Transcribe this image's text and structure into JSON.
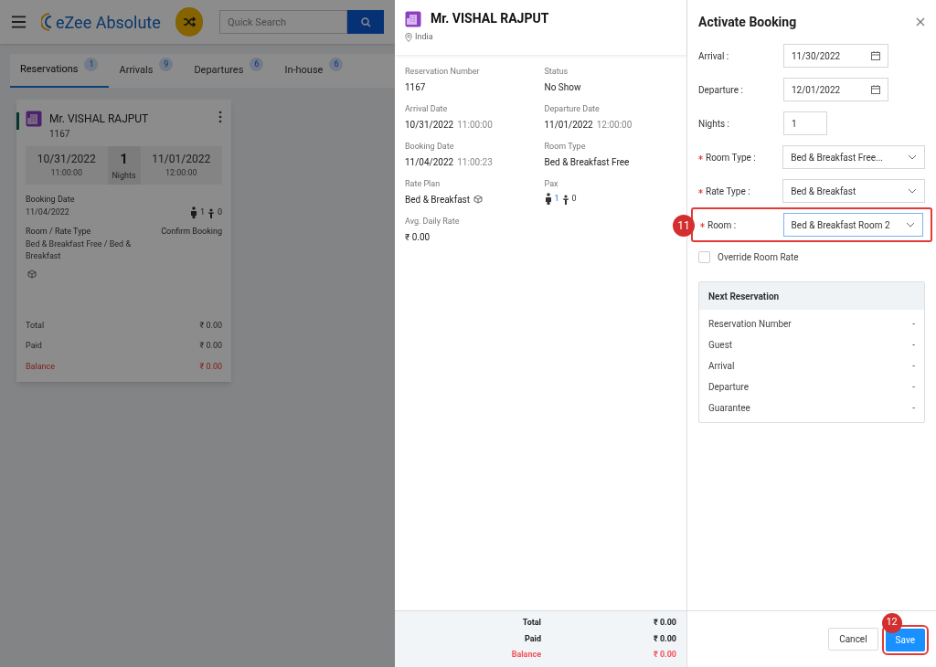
{
  "app_header": {
    "app_name": "eZee Absolute",
    "search_placeholder": "Quick Search"
  },
  "tabs": [
    {
      "label": "Reservations",
      "count": "1",
      "selected": true
    },
    {
      "label": "Arrivals",
      "count": "9",
      "selected": false
    },
    {
      "label": "Departures",
      "count": "6",
      "selected": false
    },
    {
      "label": "In-house",
      "count": "6",
      "selected": false
    }
  ],
  "reservation_card": {
    "guest": "Mr. VISHAL RAJPUT",
    "number": "1167",
    "arrival_date": "10/31/2022",
    "arrival_time": "11:00:00",
    "nights": "1",
    "nights_label": "Nights",
    "departure_date": "11/01/2022",
    "departure_time": "12:00:00",
    "booking_date_label": "Booking Date",
    "booking_date": "11/04/2022",
    "adults": "1",
    "children": "0",
    "room_rate_label": "Room / Rate Type",
    "room_rate": "Bed & Breakfast Free / Bed & Breakfast",
    "status": "Confirm Booking",
    "totals": [
      {
        "label": "Total",
        "value": "₹ 0.00",
        "kind": "normal"
      },
      {
        "label": "Paid",
        "value": "₹ 0.00",
        "kind": "normal"
      },
      {
        "label": "Balance",
        "value": "₹ 0.00",
        "kind": "balance"
      }
    ]
  },
  "details_panel": {
    "guest": "Mr. VISHAL RAJPUT",
    "country": "India",
    "fields": [
      {
        "label": "Reservation Number",
        "value": "1167",
        "kind": "text"
      },
      {
        "label": "Status",
        "value": "No Show",
        "kind": "text"
      },
      {
        "label": "Arrival Date",
        "value": "10/31/2022",
        "time": "11:00:00",
        "kind": "datetime"
      },
      {
        "label": "Departure Date",
        "value": "11/01/2022",
        "time": "12:00:00",
        "kind": "datetime"
      },
      {
        "label": "Booking Date",
        "value": "11/04/2022",
        "time": "11:00:23",
        "kind": "datetime"
      },
      {
        "label": "Room Type",
        "value": "Bed & Breakfast Free",
        "kind": "text"
      },
      {
        "label": "Rate Plan",
        "value": "Bed & Breakfast",
        "kind": "rate_plan"
      },
      {
        "label": "Pax",
        "adults": "1",
        "children": "0",
        "kind": "pax"
      },
      {
        "label": "Avg. Daily Rate",
        "value": "₹ 0.00",
        "kind": "text"
      }
    ],
    "totals": [
      {
        "label": "Total",
        "value": "₹ 0.00",
        "kind": "normal"
      },
      {
        "label": "Paid",
        "value": "₹ 0.00",
        "kind": "normal"
      },
      {
        "label": "Balance",
        "value": "₹ 0.00",
        "kind": "balance"
      }
    ]
  },
  "activate_booking": {
    "title": "Activate Booking",
    "fields": [
      {
        "label": "Arrival :",
        "value": "11/30/2022",
        "kind": "date",
        "required": false
      },
      {
        "label": "Departure :",
        "value": "12/01/2022",
        "kind": "date",
        "required": false
      },
      {
        "label": "Nights :",
        "value": "1",
        "kind": "number",
        "required": false
      },
      {
        "label": "Room Type :",
        "value": "Bed & Breakfast Free...",
        "kind": "select",
        "required": true
      },
      {
        "label": "Rate Type :",
        "value": "Bed & Breakfast",
        "kind": "select",
        "required": true
      },
      {
        "label": "Room :",
        "value": "Bed & Breakfast Room 2",
        "kind": "select",
        "required": true,
        "callout": "11"
      }
    ],
    "override": {
      "label": "Override Room Rate",
      "checked": false
    },
    "next_reservation": {
      "title": "Next Reservation",
      "rows": [
        {
          "label": "Reservation Number",
          "value": "-"
        },
        {
          "label": "Guest",
          "value": "-"
        },
        {
          "label": "Arrival",
          "value": "-"
        },
        {
          "label": "Departure",
          "value": "-"
        },
        {
          "label": "Guarantee",
          "value": "-"
        }
      ]
    },
    "buttons": [
      {
        "label": "Cancel",
        "kind": "secondary"
      },
      {
        "label": "Save",
        "kind": "primary",
        "callout": "12"
      }
    ]
  }
}
